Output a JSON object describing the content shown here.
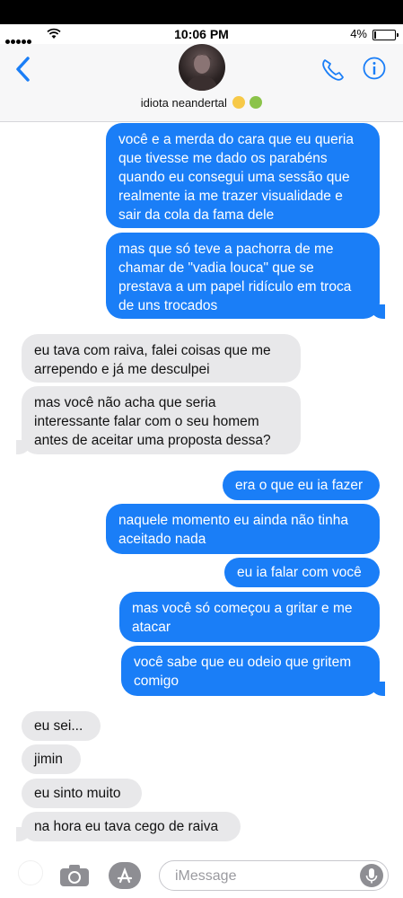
{
  "status": {
    "time": "10:06 PM",
    "battery": "4%"
  },
  "header": {
    "contact_name": "idiota neandertal"
  },
  "colors": {
    "sent": "#1a7ef7",
    "received": "#e8e8ea",
    "accent": "#1a7ef7"
  },
  "icons": [
    "back-chevron-icon",
    "phone-icon",
    "info-icon",
    "camera-icon",
    "app-store-icon",
    "microphone-icon"
  ],
  "messages": [
    {
      "dir": "sent",
      "text": "você e a merda do cara que eu queria que tivesse me dado os parabéns quando eu consegui uma sessão que realmente ia me trazer visualidade e sair da cola da fama dele"
    },
    {
      "dir": "sent",
      "text": "mas que só teve a pachorra de me chamar de \"vadia louca\" que se prestava a um papel ridículo em troca de uns trocados"
    },
    {
      "dir": "received",
      "text": "eu tava com raiva, falei coisas que me arrependo e já me desculpei"
    },
    {
      "dir": "received",
      "text": "mas você não acha que seria interessante falar com o seu homem antes de aceitar uma proposta dessa?"
    },
    {
      "dir": "sent",
      "text": "era o que eu ia fazer"
    },
    {
      "dir": "sent",
      "text": "naquele momento eu ainda não tinha aceitado nada"
    },
    {
      "dir": "sent",
      "text": "eu ia falar com você"
    },
    {
      "dir": "sent",
      "text": "mas você só começou a gritar e me atacar"
    },
    {
      "dir": "sent",
      "text": "você sabe que eu odeio que gritem comigo"
    },
    {
      "dir": "received",
      "text": "eu sei..."
    },
    {
      "dir": "received",
      "text": "jimin"
    },
    {
      "dir": "received",
      "text": "eu sinto muito"
    },
    {
      "dir": "received",
      "text": "na hora eu tava cego de raiva"
    }
  ],
  "composer": {
    "placeholder": "iMessage"
  }
}
